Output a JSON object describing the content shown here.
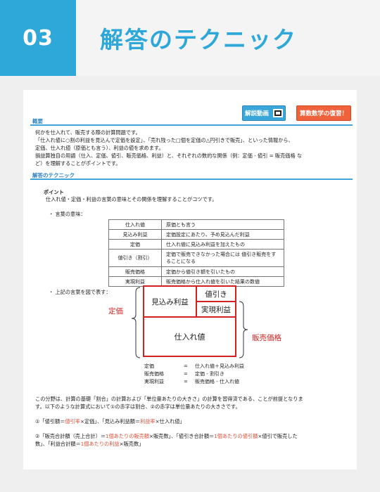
{
  "header": {
    "number": "03",
    "title": "解答のテクニック"
  },
  "buttons": {
    "video": "解説動画",
    "review": "算数数学の復習！"
  },
  "sections": {
    "overview": "概要",
    "technique": "解答のテクニック"
  },
  "overview_lines": [
    "何かを仕入れて、販売する際の計算問題です。",
    "「仕入れ値に○割の利益を見込んで定価を設定」、「売れ残った□個を定価の△円引きで販売」、といった情報から、",
    "定価、仕入れ値（原価とも言う）、利益の値を求めます。",
    "損益算独自の用語（仕入、定価、値引、販売価格、利益）と、それぞれの数的な関係（例：定価 - 値引 = 販売価格 な",
    "ど）を理解することがポイントです。"
  ],
  "point": {
    "title": "ポイント",
    "text": "仕入れ値・定価・利益の言葉の意味とその関係を理解することがコツです。",
    "bullet1": "・ 言葉の意味：",
    "bullet2": "・ 上記の言葉を図で表す："
  },
  "terms": [
    {
      "term": "仕入れ値",
      "meaning": "原価とも言う"
    },
    {
      "term": "見込み利益",
      "meaning": "定価設定にあたり、予め見込んだ利益"
    },
    {
      "term": "定価",
      "meaning": "仕入れ値に見込み利益を加えたもの"
    },
    {
      "term": "値引き（割引）",
      "meaning": "定価で販売できなかった場合には 値引き販売をすることになる"
    },
    {
      "term": "販売価格",
      "meaning": "定価から値引き額を引いたもの"
    },
    {
      "term": "実現利益",
      "meaning": "販売価格から仕入れ値を引いた結果の数値"
    }
  ],
  "diagram": {
    "profit": "見込み利益",
    "discount": "値引き",
    "real_profit": "実現利益",
    "cost": "仕入れ値",
    "left_label": "定価",
    "right_label": "販売価格"
  },
  "formulas": [
    {
      "lhs": "定価",
      "eq": "=",
      "rhs": "仕入れ値＋見込み利益"
    },
    {
      "lhs": "販売価格",
      "eq": "=",
      "rhs": "定価 - 割引き"
    },
    {
      "lhs": "実現利益",
      "eq": "=",
      "rhs": "販売価格 - 仕入れ値"
    }
  ],
  "explanation": {
    "line1": "この分野は、計算の基礎「割合」の計算および「単位量あたりの大きさ」の計算を習得済である、ことが前提となりま",
    "line2": "す。以下のような計算式において①の赤字は割合、②の赤字は単位量あたりの大きさです。"
  },
  "rule1": {
    "p1": "①「値引額＝",
    "r1": "値引率",
    "p2": "×定価」、「見込み利益額＝",
    "r2": "利益率",
    "p3": "×仕入れ値」"
  },
  "rule2": {
    "p1": "②「販売合計額（売上合計）＝",
    "r1": "1個あたりの販売額",
    "p2": "×販売数」、「値引き合計額＝",
    "r2": "1個あたりの値引額",
    "p3": "×値引で販売した",
    "p4": "数」、「利益合計額＝",
    "r3": "1個あたりの利益",
    "p5": "×販売数」"
  },
  "colors": {
    "accent": "#2ea8d8",
    "red": "#d42020",
    "orange": "#f0623c"
  }
}
